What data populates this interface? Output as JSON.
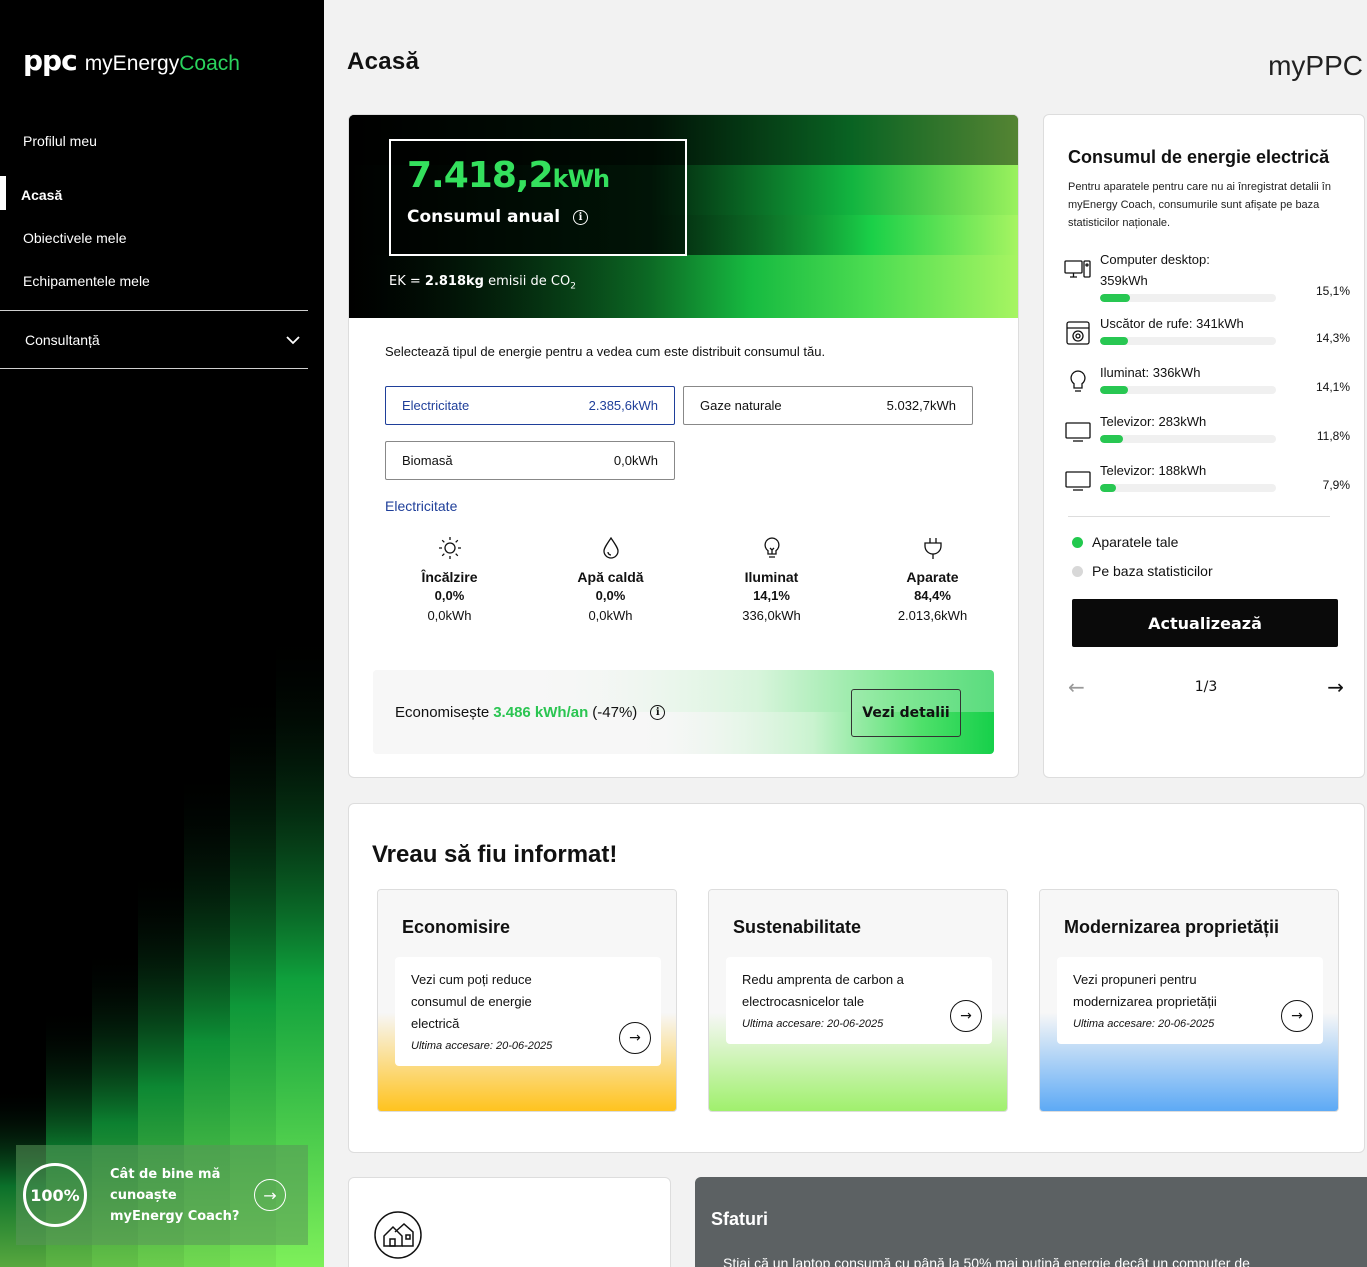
{
  "sidebar": {
    "logo_ppc": "ppc",
    "logo_my": "myEnergy",
    "logo_coach": "Coach",
    "nav": [
      {
        "label": "Profilul meu"
      },
      {
        "label": "Acasă"
      },
      {
        "label": "Obiectivele mele"
      },
      {
        "label": "Echipamentele mele"
      }
    ],
    "consult_label": "Consultanță",
    "promo": {
      "percent": "100%",
      "text": "Cât de bine mă cunoaște myEnergy Coach?"
    }
  },
  "header": {
    "title": "Acasă",
    "brand": "myPPC"
  },
  "consumption": {
    "annual_value": "7.418,2",
    "annual_unit": "kWh",
    "annual_label": "Consumul anual",
    "co2_prefix": "EK = ",
    "co2_value": "2.818kg",
    "co2_suffix": " emisii de CO",
    "co2_sub": "2",
    "select_text": "Selectează tipul de energie pentru a vedea cum este distribuit consumul tău.",
    "types": [
      {
        "name": "Electricitate",
        "value": "2.385,6kWh"
      },
      {
        "name": "Gaze naturale",
        "value": "5.032,7kWh"
      },
      {
        "name": "Biomasă",
        "value": "0,0kWh"
      }
    ],
    "selected_label": "Electricitate",
    "categories": [
      {
        "icon": "sun-icon",
        "name": "Încălzire",
        "percent": "0,0%",
        "kwh": "0,0kWh"
      },
      {
        "icon": "water-drop-icon",
        "name": "Apă caldă",
        "percent": "0,0%",
        "kwh": "0,0kWh"
      },
      {
        "icon": "lightbulb-icon",
        "name": "Iluminat",
        "percent": "14,1%",
        "kwh": "336,0kWh"
      },
      {
        "icon": "plug-icon",
        "name": "Aparate",
        "percent": "84,4%",
        "kwh": "2.013,6kWh"
      }
    ],
    "save_prefix": "Economisește",
    "save_value": "3.486 kWh/an",
    "save_suffix": "(-47%)",
    "save_button": "Vezi detalii"
  },
  "electric": {
    "title": "Consumul de energie electrică",
    "description": "Pentru aparatele pentru care nu ai înregistrat detalii în myEnergy Coach, consumurile sunt afișate pe baza statisticilor naționale.",
    "devices": [
      {
        "icon": "desktop-computer-icon",
        "name": "Computer desktop: 359kWh",
        "percent": "15,1%",
        "level": 0.151
      },
      {
        "icon": "dryer-icon",
        "name": "Uscător de rufe: 341kWh",
        "percent": "14,3%",
        "level": 0.143
      },
      {
        "icon": "lightbulb-icon",
        "name": "Iluminat: 336kWh",
        "percent": "14,1%",
        "level": 0.141
      },
      {
        "icon": "tv-icon",
        "name": "Televizor: 283kWh",
        "percent": "11,8%",
        "level": 0.118
      },
      {
        "icon": "tv-icon",
        "name": "Televizor: 188kWh",
        "percent": "7,9%",
        "level": 0.079
      }
    ],
    "legend_own": "Aparatele tale",
    "legend_stats": "Pe baza statisticilor",
    "legend_own_color": "#22c94e",
    "legend_stats_color": "#d8d8d8",
    "update_button": "Actualizează",
    "page": "1/3"
  },
  "info": {
    "title": "Vreau să fiu informat!",
    "cards": [
      {
        "title": "Economisire",
        "text": "Vezi cum poți reduce consumul de energie electrică",
        "date": "Ultima accesare: 20-06-2025",
        "color": "#ffc21a"
      },
      {
        "title": "Sustenabilitate",
        "text": "Redu amprenta de carbon a electrocasnicelor tale",
        "date": "Ultima accesare: 20-06-2025",
        "color": "#9ef06a"
      },
      {
        "title": "Modernizarea proprietății",
        "text": "Vezi propuneri pentru modernizarea proprietății",
        "date": "Ultima accesare: 20-06-2025",
        "color": "#5aa8f5"
      }
    ]
  },
  "tips": {
    "title": "Sfaturi",
    "text": "Știai că un laptop consumă cu până la 50% mai puțină energie decât un computer de"
  }
}
